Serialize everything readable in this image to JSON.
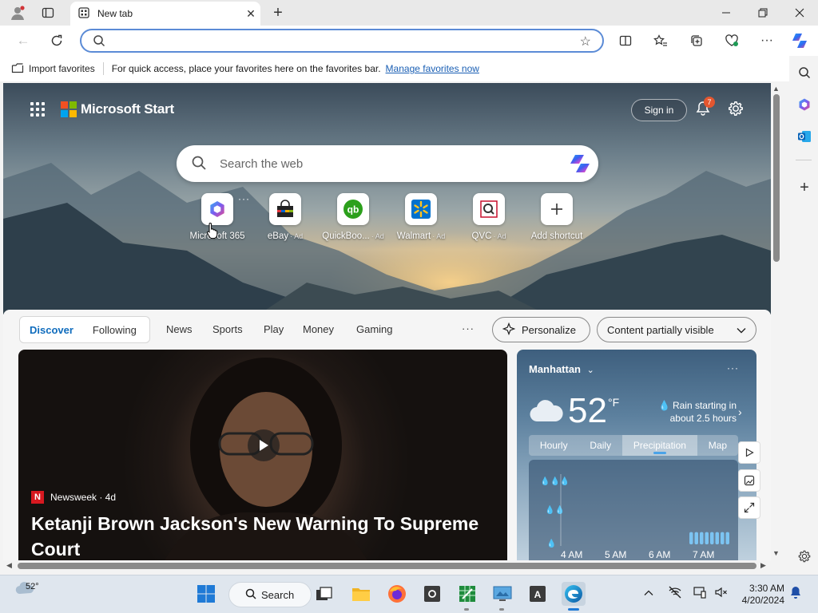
{
  "browser": {
    "tab_title": "New tab",
    "address_value": "",
    "favorites_bar": {
      "import_label": "Import favorites",
      "message": "For quick access, place your favorites here on the favorites bar.",
      "manage_link": "Manage favorites now"
    }
  },
  "start": {
    "brand": "Microsoft Start",
    "sign_in": "Sign in",
    "notification_count": "7",
    "search_placeholder": "Search the web",
    "shortcuts": [
      {
        "label": "Microsoft 365",
        "ad": ""
      },
      {
        "label": "eBay",
        "ad": "· Ad"
      },
      {
        "label": "QuickBoo...",
        "ad": "· Ad"
      },
      {
        "label": "Walmart",
        "ad": "· Ad"
      },
      {
        "label": "QVC",
        "ad": "· Ad"
      },
      {
        "label": "Add shortcut",
        "ad": ""
      }
    ]
  },
  "feed": {
    "pill_tabs": [
      "Discover",
      "Following"
    ],
    "nav": [
      "News",
      "Sports",
      "Play",
      "Money",
      "Gaming"
    ],
    "personalize": "Personalize",
    "content_visibility": "Content partially visible"
  },
  "news": {
    "source": "Newsweek · 4d",
    "headline": "Ketanji Brown Jackson's New Warning To Supreme Court"
  },
  "weather": {
    "location": "Manhattan",
    "temp": "52",
    "unit": "°F",
    "rain_line1": "Rain starting in",
    "rain_line2": "about 2.5 hours",
    "tabs": [
      "Hourly",
      "Daily",
      "Precipitation",
      "Map"
    ],
    "times": [
      "4 AM",
      "5 AM",
      "6 AM",
      "7 AM"
    ],
    "precip_bars": [
      0,
      0,
      0,
      0,
      0,
      0,
      0,
      0,
      0,
      0,
      0,
      0,
      0,
      0,
      0,
      0,
      0,
      0,
      0,
      0,
      0,
      0,
      0,
      0,
      1,
      1,
      1,
      1,
      1,
      1,
      1,
      1
    ]
  },
  "taskbar": {
    "weather_temp": "52°",
    "search_label": "Search",
    "time": "3:30 AM",
    "date": "4/20/2024"
  },
  "colors": {
    "accent": "#0f6cbd",
    "notification_badge": "#e3562f",
    "link": "#1a5fb4"
  }
}
